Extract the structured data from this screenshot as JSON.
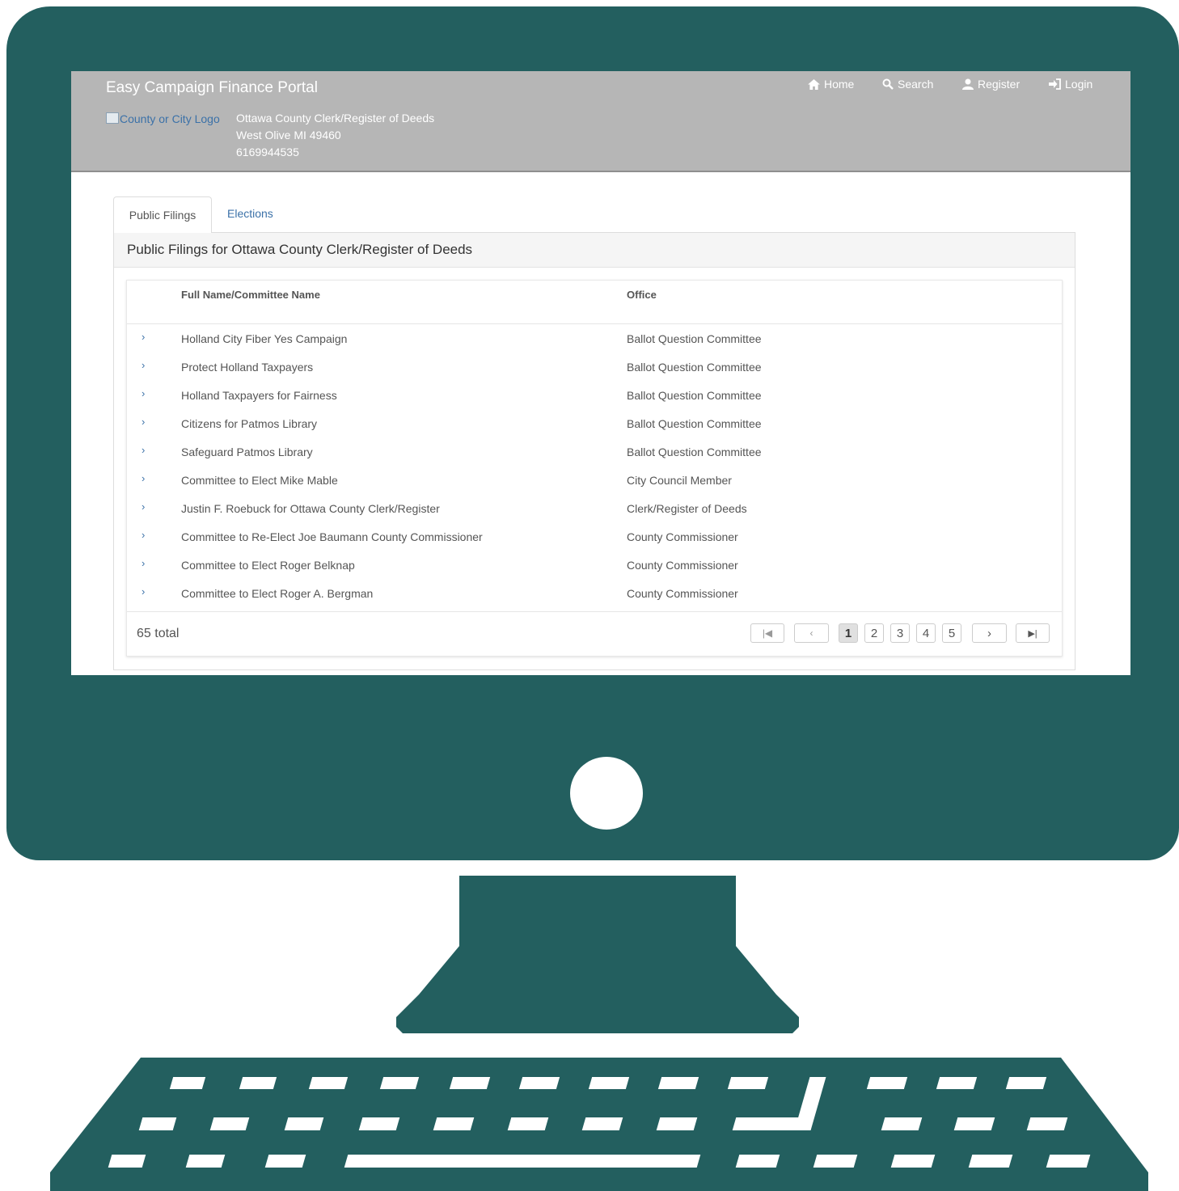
{
  "header": {
    "brand": "Easy Campaign Finance Portal",
    "logo_alt": "County or City Logo",
    "address_lines": [
      "Ottawa County Clerk/Register of Deeds",
      "West Olive MI 49460",
      "6169944535"
    ],
    "nav": [
      {
        "label": "Home",
        "icon": "home-icon"
      },
      {
        "label": "Search",
        "icon": "search-icon"
      },
      {
        "label": "Register",
        "icon": "user-icon"
      },
      {
        "label": "Login",
        "icon": "login-icon"
      }
    ]
  },
  "tabs": [
    {
      "label": "Public Filings",
      "active": true
    },
    {
      "label": "Elections",
      "active": false
    }
  ],
  "panel": {
    "heading": "Public Filings for Ottawa County Clerk/Register of Deeds",
    "columns": [
      "Full Name/Committee Name",
      "Office"
    ],
    "rows": [
      {
        "name": "Holland City Fiber Yes Campaign",
        "office": "Ballot Question Committee"
      },
      {
        "name": "Protect Holland Taxpayers",
        "office": "Ballot Question Committee"
      },
      {
        "name": "Holland Taxpayers for Fairness",
        "office": "Ballot Question Committee"
      },
      {
        "name": "Citizens for Patmos Library",
        "office": "Ballot Question Committee"
      },
      {
        "name": "Safeguard Patmos Library",
        "office": "Ballot Question Committee"
      },
      {
        "name": "Committee to Elect Mike Mable",
        "office": "City Council Member"
      },
      {
        "name": "Justin F. Roebuck for Ottawa County Clerk/Register",
        "office": "Clerk/Register of Deeds"
      },
      {
        "name": "Committee to Re-Elect Joe Baumann County Commissioner",
        "office": "County Commissioner"
      },
      {
        "name": "Committee to Elect Roger Belknap",
        "office": "County Commissioner"
      },
      {
        "name": "Committee to Elect Roger A. Bergman",
        "office": "County Commissioner"
      }
    ],
    "total": "65 total",
    "pagination": {
      "first": "|◀",
      "prev": "‹",
      "pages": [
        "1",
        "2",
        "3",
        "4",
        "5"
      ],
      "current": "1",
      "next": "›",
      "last": "▶|"
    }
  },
  "colors": {
    "monitor": "#235f5f",
    "header_bg": "#b6b6b6",
    "link": "#3b71a8"
  }
}
